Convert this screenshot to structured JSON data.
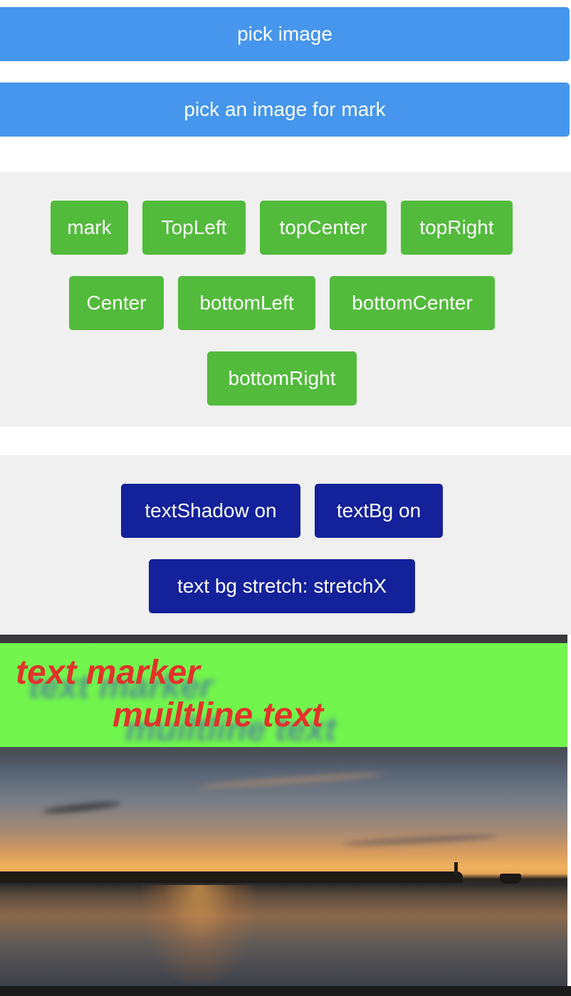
{
  "buttons": {
    "pick_image": "pick image",
    "pick_mark_image": "pick an image for mark"
  },
  "position_buttons": [
    "mark",
    "TopLeft",
    "topCenter",
    "topRight",
    "Center",
    "bottomLeft",
    "bottomCenter",
    "bottomRight"
  ],
  "style_buttons": {
    "text_shadow": "textShadow on",
    "text_bg": "textBg on",
    "stretch": "text bg stretch: stretchX"
  },
  "preview": {
    "marker_lines": [
      "text marker",
      "muiltline text"
    ],
    "marker_text_color": "#e3322b",
    "marker_bg_color": "#72f64d",
    "image_subject": "sunset over water"
  },
  "colors": {
    "primary_blue": "#4596ec",
    "green": "#52bb3b",
    "navy": "#13219a",
    "panel_bg": "#f0f0f0"
  }
}
